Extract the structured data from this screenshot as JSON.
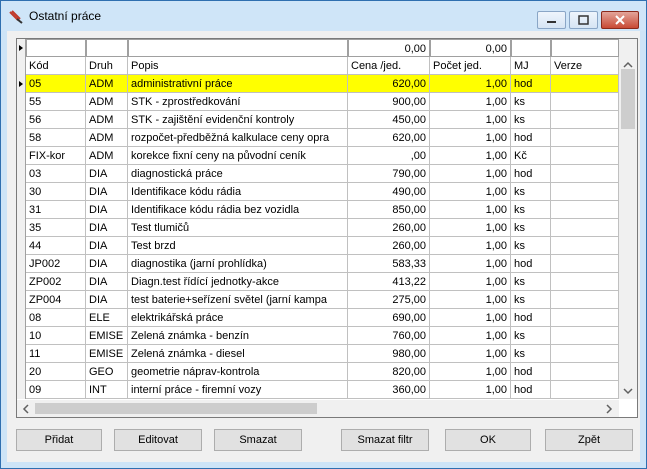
{
  "window": {
    "title": "Ostatní práce"
  },
  "filter_row": {
    "kod": "",
    "druh": "",
    "popis": "",
    "cena": "0,00",
    "pocet": "0,00",
    "mj": "",
    "verze": ""
  },
  "columns": [
    "Kód",
    "Druh",
    "Popis",
    "Cena /jed.",
    "Počet jed.",
    "MJ",
    "Verze"
  ],
  "rows": [
    {
      "kod": "05",
      "druh": "ADM",
      "popis": "administrativní práce",
      "cena": "620,00",
      "pocet": "1,00",
      "mj": "hod",
      "verze": ""
    },
    {
      "kod": "55",
      "druh": "ADM",
      "popis": "STK - zprostředkování",
      "cena": "900,00",
      "pocet": "1,00",
      "mj": "ks",
      "verze": ""
    },
    {
      "kod": "56",
      "druh": "ADM",
      "popis": "STK - zajištění evidenční kontroly",
      "cena": "450,00",
      "pocet": "1,00",
      "mj": "ks",
      "verze": ""
    },
    {
      "kod": "58",
      "druh": "ADM",
      "popis": "rozpočet-předběžná kalkulace ceny opra",
      "cena": "620,00",
      "pocet": "1,00",
      "mj": "hod",
      "verze": ""
    },
    {
      "kod": "FIX-kor",
      "druh": "ADM",
      "popis": "korekce fixní ceny na původní ceník",
      "cena": ",00",
      "pocet": "1,00",
      "mj": "Kč",
      "verze": ""
    },
    {
      "kod": "03",
      "druh": "DIA",
      "popis": "diagnostická práce",
      "cena": "790,00",
      "pocet": "1,00",
      "mj": "hod",
      "verze": ""
    },
    {
      "kod": "30",
      "druh": "DIA",
      "popis": "Identifikace kódu rádia",
      "cena": "490,00",
      "pocet": "1,00",
      "mj": "ks",
      "verze": ""
    },
    {
      "kod": "31",
      "druh": "DIA",
      "popis": "Identifikace kódu rádia bez vozidla",
      "cena": "850,00",
      "pocet": "1,00",
      "mj": "ks",
      "verze": ""
    },
    {
      "kod": "35",
      "druh": "DIA",
      "popis": "Test tlumičů",
      "cena": "260,00",
      "pocet": "1,00",
      "mj": "ks",
      "verze": ""
    },
    {
      "kod": "44",
      "druh": "DIA",
      "popis": "Test brzd",
      "cena": "260,00",
      "pocet": "1,00",
      "mj": "ks",
      "verze": ""
    },
    {
      "kod": "JP002",
      "druh": "DIA",
      "popis": "diagnostika (jarní prohlídka)",
      "cena": "583,33",
      "pocet": "1,00",
      "mj": "hod",
      "verze": ""
    },
    {
      "kod": "ZP002",
      "druh": "DIA",
      "popis": "Diagn.test řídící jednotky-akce",
      "cena": "413,22",
      "pocet": "1,00",
      "mj": "ks",
      "verze": ""
    },
    {
      "kod": "ZP004",
      "druh": "DIA",
      "popis": "test baterie+seřízení světel (jarní kampa",
      "cena": "275,00",
      "pocet": "1,00",
      "mj": "ks",
      "verze": ""
    },
    {
      "kod": "08",
      "druh": "ELE",
      "popis": "elektrikářská práce",
      "cena": "690,00",
      "pocet": "1,00",
      "mj": "hod",
      "verze": ""
    },
    {
      "kod": "10",
      "druh": "EMISE",
      "popis": "Zelená známka - benzín",
      "cena": "760,00",
      "pocet": "1,00",
      "mj": "ks",
      "verze": ""
    },
    {
      "kod": "11",
      "druh": "EMISE",
      "popis": "Zelená známka - diesel",
      "cena": "980,00",
      "pocet": "1,00",
      "mj": "ks",
      "verze": ""
    },
    {
      "kod": "20",
      "druh": "GEO",
      "popis": "geometrie náprav-kontrola",
      "cena": "820,00",
      "pocet": "1,00",
      "mj": "hod",
      "verze": ""
    },
    {
      "kod": "09",
      "druh": "INT",
      "popis": "interní práce - firemní vozy",
      "cena": "360,00",
      "pocet": "1,00",
      "mj": "hod",
      "verze": ""
    }
  ],
  "buttons": {
    "pridat": "Přidat",
    "editovat": "Editovat",
    "smazat": "Smazat",
    "smazat_filtr": "Smazat filtr",
    "ok": "OK",
    "zpet": "Zpět"
  },
  "colors": {
    "selected_row": "#ffff00"
  }
}
